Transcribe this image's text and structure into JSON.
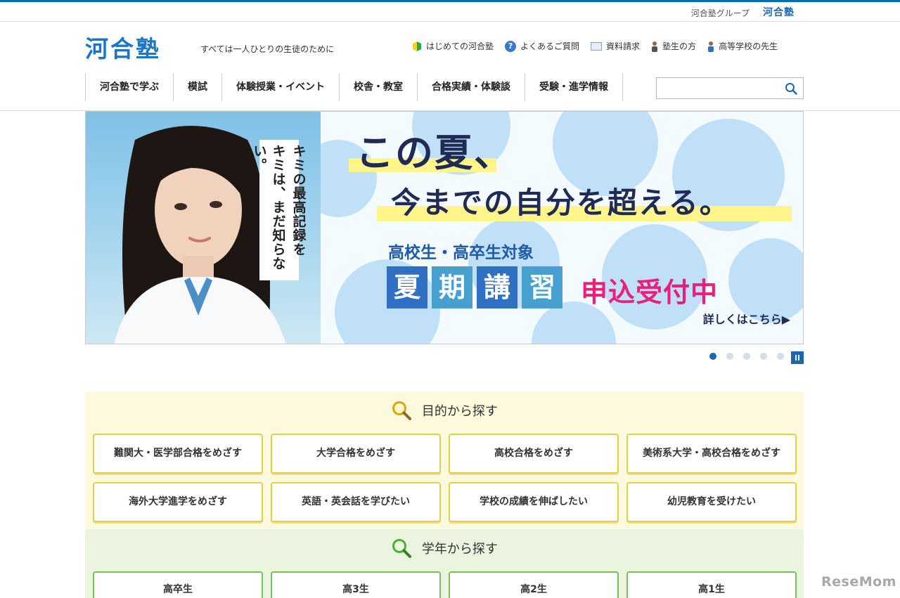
{
  "group_bar": {
    "label": "河合塾グループ",
    "logo": "河合塾"
  },
  "header": {
    "logo": "河合塾",
    "tagline": "すべては一人ひとりの生徒のために",
    "utility_links": [
      {
        "label": "はじめての河合塾",
        "icon": "beginner-leaf-icon"
      },
      {
        "label": "よくあるご質問",
        "icon": "question-icon"
      },
      {
        "label": "資料請求",
        "icon": "document-icon"
      },
      {
        "label": "塾生の方",
        "icon": "student-icon"
      },
      {
        "label": "高等学校の先生",
        "icon": "teacher-icon"
      }
    ]
  },
  "nav": [
    {
      "label": "河合塾で学ぶ"
    },
    {
      "label": "模試"
    },
    {
      "label": "体験授業・イベント"
    },
    {
      "label": "校舎・教室"
    },
    {
      "label": "合格実績・体験談"
    },
    {
      "label": "受験・進学情報"
    }
  ],
  "search": {
    "value": "",
    "placeholder": ""
  },
  "hero": {
    "vertical_copy": [
      "キミの最高記録を",
      "キミは、まだ知らない。"
    ],
    "headline1": "この夏、",
    "headline2": "今までの自分を超える。",
    "target": "高校生・高卒生対象",
    "kanji": [
      "夏",
      "期",
      "講",
      "習"
    ],
    "kanji_colors": [
      "#2f6fc4",
      "#48a0d0",
      "#2f6fc4",
      "#48a0d0"
    ],
    "accept": "申込受付中",
    "more": "詳しくはこちら▶"
  },
  "carousel": {
    "slides": 5,
    "active": 1
  },
  "purpose_section": {
    "title": "目的から探す",
    "buttons": [
      "難関大・医学部合格をめざす",
      "大学合格をめざす",
      "高校合格をめざす",
      "美術系大学・高校合格をめざす",
      "海外大学進学をめざす",
      "英語・英会話を学びたい",
      "学校の成績を伸ばしたい",
      "幼児教育を受けたい"
    ]
  },
  "grade_section": {
    "title": "学年から探す",
    "buttons": [
      "高卒生",
      "高3生",
      "高2生",
      "高1生"
    ]
  },
  "watermark": "ReseMom",
  "colors": {
    "brand": "#1b77c6",
    "purpose_bg": "#fdf9dc",
    "grade_bg": "#eaf4df",
    "accent_pink": "#e8207a"
  }
}
